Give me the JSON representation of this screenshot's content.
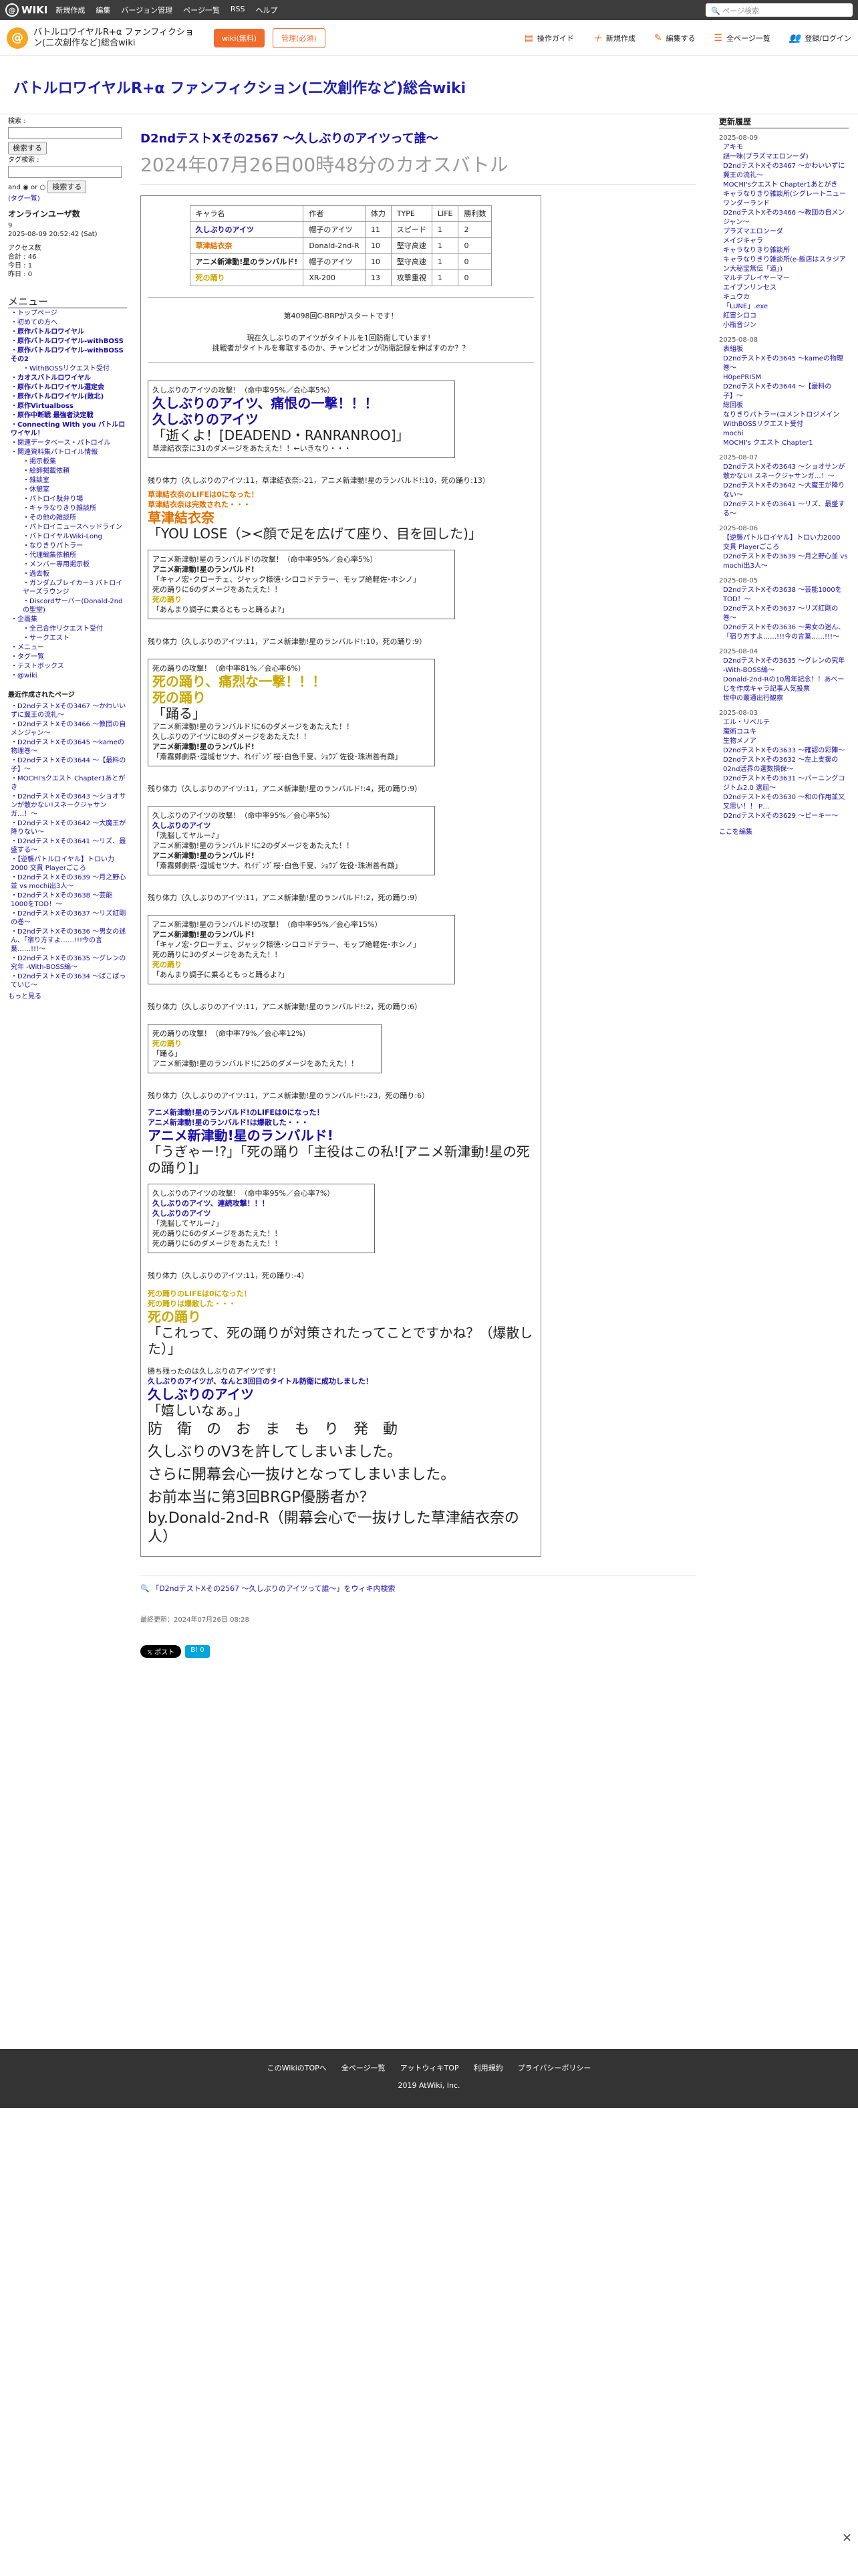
{
  "topbar": {
    "logo": "WIKI",
    "menu": [
      "新規作成",
      "編集",
      "バージョン管理",
      "ページ一覧",
      "RSS",
      "ヘルプ"
    ],
    "search_placeholder": "ページ検索"
  },
  "secbar": {
    "wiki_name": "バトルロワイヤルR+α ファンフィクション(二次創作など)総合wiki",
    "wiki_btn": "wiki(無料)",
    "login_btn": "管理(必須)",
    "actions": [
      "操作ガイド",
      "新規作成",
      "編集する",
      "全ページ一覧",
      "登録/ログイン"
    ]
  },
  "wiki_title": "バトルロワイヤルR+α ファンフィクション(二次創作など)総合wiki",
  "left": {
    "search_label": "検索 :",
    "search_btn": "検索する",
    "tag_search": "タグ検索 :",
    "and": "and",
    "or": "or",
    "tag_list": "(タグ一覧)",
    "online": "オンラインユーザ数",
    "online_count": "9",
    "datetime": "2025-08-09 20:52:42 (Sat)",
    "access": "アクセス数",
    "total": "合計 : 46",
    "today": "今日 : 1",
    "yesterday": "昨日 : 0",
    "menu_title": "メニュー",
    "menu": [
      "トップページ",
      "初めての方へ",
      "原作バトルロワイヤル",
      "原作バトルロワイヤル-withBOSS",
      "原作バトルロワイヤル-withBOSSその2",
      "WithBOSSリクエスト受付",
      "カオスバトルロワイヤル",
      "原作バトルロワイヤル選定会",
      "原作バトルロワイヤル(敗北)",
      "原作Virtualboss",
      "原作中断戦 最強者決定戦",
      "Connecting With you バトルロワイヤル！",
      "関連データベース・パトロイル",
      "関連資料集パトロイル情報",
      "掲示板集",
      "絵師掲載依頼",
      "雑談室",
      "休憩室",
      "パトロイ駄弁り場",
      "キャラなりきり雑談所",
      "その他の雑談所",
      "パトロイニュースヘッドライン",
      "パトロイヤルWiki-Long",
      "なりきりパトラー",
      "代理編集依頼所",
      "メンバー専用掲示板",
      "過去板",
      "ガンダムブレイカー3 パトロイヤーズラウンジ",
      "Discordサーバー(Donald-2ndの聖堂)",
      "企画集",
      "全己合作リクエスト受付",
      "サークエスト",
      "メニュー",
      "タグ一覧",
      "テストボックス",
      "@wiki"
    ],
    "recent_title": "最近作成されたページ",
    "recent": [
      "D2ndテストXその3467 〜かわいいずに冀王の流礼〜",
      "D2ndテストXその3466 〜教団の自メンジャン〜",
      "D2ndテストXその3645 〜kameの物理巻〜",
      "D2ndテストXその3644 〜【最料の子】〜",
      "MOCHI'sクエスト Chapter1あとがき",
      "D2ndテストXその3643 〜ショオサンが散かない!スネークジャサンガ…！〜",
      "D2ndテストXその3642 〜大魔王が降りない〜",
      "D2ndテストXその3641 〜リズ、最盛する〜",
      "【逆襲パトルロイヤル】トロい力2000 交貫 Playerごころ",
      "D2ndテストXその3639 〜月之野心並 vs mochi出3人〜",
      "D2ndテストXその3638 〜芸能1000をTOD！〜",
      "D2ndテストXその3637 〜リズ紅剛の巻〜",
      "D2ndテストXその3636 〜男女の迷ん、「宿り方すよ……!!!今の言葉……!!!〜",
      "D2ndテストXその3635 〜グレンの究年 -With-BOSS編〜",
      "D2ndテストXその3634 〜ばこばっていじ〜"
    ],
    "more": "もっと見る"
  },
  "article": {
    "title": "D2ndテストXその2567 〜久しぶりのアイツって誰〜",
    "subtitle": "2024年07月26日00時48分のカオスバトル",
    "table_header": [
      "キャラ名",
      "作者",
      "体力",
      "TYPE",
      "LIFE",
      "勝利数"
    ],
    "table_rows": [
      [
        "久しぶりのアイツ",
        "帽子のアイツ",
        "11",
        "スピード",
        "1",
        "2"
      ],
      [
        "草津結衣奈",
        "Donald-2nd-R",
        "10",
        "堅守高速",
        "1",
        "0"
      ],
      [
        "アニメ新津動!星のランバルド!",
        "帽子のアイツ",
        "10",
        "堅守高速",
        "1",
        "0"
      ],
      [
        "死の踊り",
        "XR-200",
        "13",
        "攻撃重視",
        "1",
        "0"
      ]
    ],
    "intro1": "第4098回C-BRPがスタートです！",
    "intro2": "現在久しぶりのアイツがタイトルを1回防衛しています！",
    "intro3": "挑戦者がタイトルを奪取するのか、チャンピオンが防衛記録を伸ばすのか？？",
    "turns": [
      {
        "lines": [
          "久しぶりのアイツの攻撃！（命中率95%／会心率5%）",
          "久しぶりのアイツ、痛恨の一撃！！！",
          "久しぶりのアイツ",
          "「逝くよ！[DEADEND・RANRANROO]」",
          "草津結衣奈に31のダメージをあたえた！！←いきなり・・・"
        ],
        "remain": "残り体力（久しぶりのアイツ:11，草津結衣奈:-21，アニメ新津動!星のランバルド!:10，死の踊り:13）"
      },
      {
        "lines": [
          "草津結衣奈のLIFEは0になった！",
          "草津結衣奈は完敗された・・・",
          "草津結衣奈",
          "「YOU LOSE（><顔で足を広げて座り、目を回した)」"
        ]
      },
      {
        "lines": [
          "アニメ新津動!星のランバルド!の攻撃！（命中率95%／会心率5%）",
          "アニメ新津動!星のランバルド!",
          "「キャノ宏･クローチェ、ジャック様徳･シロコドテラー、モップ絶軽佐･ホシノ」",
          "死の踊りに6のダメージをあたえた！！",
          "死の踊り",
          "「あんまり調子に乗るともっと踊るよ?」"
        ],
        "remain": "残り体力（久しぶりのアイツ:11，アニメ新津動!星のランバルド!:10，死の踊り:9）"
      },
      {
        "lines": [
          "死の踊りの攻撃！（命中率81%／会心率6%）",
          "死の踊り、痛烈な一撃！！！",
          "死の踊り",
          "「踊る」",
          "アニメ新津動!星のランバルド!に6のダメージをあたえた！！",
          "久しぶりのアイツに8のダメージをあたえた！！",
          "アニメ新津動!星のランバルド!",
          "「斎霧鄭劇祭･湿城セツナ、れｲﾃﾞﾝｸﾞ桜･白色千夏、ｼｮｳﾌﾞ佐役･珠洲善有鵡」"
        ],
        "remain": "残り体力（久しぶりのアイツ:11，アニメ新津動!星のランバルド!:4，死の踊り:9）"
      },
      {
        "lines": [
          "久しぶりのアイツの攻撃！（命中率95%／会心率5%）",
          "久しぶりのアイツ",
          "「洗脳してヤルー♪」",
          "アニメ新津動!星のランバルド!に2のダメージをあたえた！！",
          "アニメ新津動!星のランバルド!",
          "「斎霧鄭劇祭･湿城セツナ、れｲﾃﾞﾝｸﾞ桜･白色千夏、ｼｮｳﾌﾞ佐役･珠洲善有鵡」"
        ],
        "remain": "残り体力（久しぶりのアイツ:11，アニメ新津動!星のランバルド!:2，死の踊り:9）"
      },
      {
        "lines": [
          "アニメ新津動!星のランバルド!の攻撃！（命中率95%／会心率15%）",
          "アニメ新津動!星のランバルド!",
          "「キャノ宏･クローチェ、ジャック様徳･シロコドテラー、モップ絶軽佐･ホシノ」",
          "死の踊りに3のダメージをあたえた！！",
          "死の踊り",
          "「あんまり調子に乗るともっと踊るよ?」"
        ],
        "remain": "残り体力（久しぶりのアイツ:11，アニメ新津動!星のランバルド!:2，死の踊り:6）"
      },
      {
        "lines": [
          "死の踊りの攻撃！（命中率79%／会心率12%）",
          "死の踊り",
          "「踊る」",
          "アニメ新津動!星のランバルド!に25のダメージをあたえた！！"
        ],
        "remain": "残り体力（久しぶりのアイツ:11，アニメ新津動!星のランバルド!:-23，死の踊り:6）"
      },
      {
        "lines": [
          "アニメ新津動!星のランバルド!のLIFEは0になった！",
          "アニメ新津動!星のランバルド!は爆散した・・・",
          "アニメ新津動!星のランバルド!",
          "「うぎゃー!?」「死の踊り「主役はこの私![アニメ新津動!星の死の踊り]」"
        ]
      },
      {
        "lines": [
          "久しぶりのアイツの攻撃！（命中率95%／会心率7%）",
          "久しぶりのアイツ、連続攻撃！！！",
          "久しぶりのアイツ",
          "「洗脳してヤルー♪」",
          "死の踊りに6のダメージをあたえた！！",
          "死の踊りに6のダメージをあたえた！！"
        ],
        "remain": "残り体力（久しぶりのアイツ:11，死の踊り:-4）"
      },
      {
        "lines": [
          "死の踊りのLIFEは0になった！",
          "死の踊りは爆散した・・・",
          "死の踊り",
          "「これって、死の踊りが対策されたってことですかね？（爆散した）」"
        ]
      }
    ],
    "winner": "勝ち残ったのは久しぶりのアイツです！",
    "winner2": "久しぶりのアイツが、なんと3回目のタイトル防衛に成功しました！",
    "final_name": "久しぶりのアイツ",
    "final_quote": "「嬉しいなぁ。」",
    "ending": [
      "防　衛　の　お　ま　も　り　発　動",
      "久しぶりのV3を許してしまいました。",
      "さらに開幕会心一抜けとなってしまいました。",
      "お前本当に第3回BRGP優勝者か？",
      "by.Donald-2nd-R（開幕会心で一抜けした草津結衣奈の人）"
    ],
    "search_link": "「D2ndテストXその2567 〜久しぶりのアイツって誰〜」をウィキ内検索",
    "updated": "最終更新：2024年07月26日 08:28",
    "tweet": "ポスト",
    "hatena": "B! 0"
  },
  "right": {
    "title": "更新履歴",
    "groups": [
      {
        "date": "2025-08-09",
        "items": [
          "アキモ",
          "謎一味(プラズマエロンーダ)",
          "D2ndテストXその3467 〜かわいいずに冀王の流礼〜",
          "MOCHI'sクエスト Chapter1あとがき",
          "キャラなりきり雑談所(シグレートニューワンダーランド",
          "D2ndテストXその3466 〜教団の自メンジャン〜",
          "プラズマエロンーダ",
          "メイジキャラ",
          "キャラなりきり雑談所",
          "キャラなりきり雑談所(e-飯店はスタジアン大秘宝無伝「道」)",
          "マルチプレイヤーマー",
          "エイブンリンセス",
          "キュウカ",
          "「LUNE」.exe",
          "紅宙シロコ",
          "小瓶音ジン"
        ]
      },
      {
        "date": "2025-08-08",
        "items": [
          "表組板",
          "D2ndテストXその3645 〜kameの物理巻〜",
          "H0pePRISM",
          "D2ndテストXその3644 〜【最料の子】〜",
          "総回板",
          "なりきりパトラー(ユメントロジメイン",
          "WithBOSSリクエスト受付",
          "mochi",
          "MOCHI's クエスト Chapter1"
        ]
      },
      {
        "date": "2025-08-07",
        "items": [
          "D2ndテストXその3643 〜ショオサンが散かない! スネークジャサンガ…！〜",
          "D2ndテストXその3642 〜大魔王が降りない〜",
          "D2ndテストXその3641 〜リズ、最盛する〜"
        ]
      },
      {
        "date": "2025-08-06",
        "items": [
          "【逆襲パトルロイヤル】トロい力2000 交貫 Playerごころ",
          "D2ndテストXその3639 〜月之野心並 vs mochi出3人〜"
        ]
      },
      {
        "date": "2025-08-05",
        "items": [
          "D2ndテストXその3638 〜芸能1000をTOD！〜",
          "D2ndテストXその3637 〜リズ紅剛の巻〜",
          "D2ndテストXその3636 〜男女の迷ん、「宿り方すよ……!!!今の言葉……!!!〜"
        ]
      },
      {
        "date": "2025-08-04",
        "items": [
          "D2ndテストXその3635 〜グレンの究年 -With-BOSS編〜",
          "Donald-2nd-Rの10周年記念！！あべーじを作成キャラ記事人気投票",
          "世中の叢通出行観察"
        ]
      },
      {
        "date": "2025-08-03",
        "items": [
          "エル・リベルテ",
          "魔術コユキ",
          "生物メノア",
          "D2ndテストXその3633 〜確認の彩陣〜",
          "D2ndテストXその3632 〜左上支援の02nd活界の選数損保〜",
          "D2ndテストXその3631 〜パーニングコジトム2.0 選屈〜",
          "D2ndテストXその3630 〜和の作用並又又思い！！ P…",
          "D2ndテストXその3629 〜ピーキー〜"
        ]
      }
    ],
    "more": "ここを編集"
  },
  "footer": {
    "links": [
      "このWikiのTOPへ",
      "全ページ一覧",
      "アットウィキTOP",
      "利用規約",
      "プライバシーポリシー"
    ],
    "copyright": "2019 AtWiki, Inc."
  }
}
